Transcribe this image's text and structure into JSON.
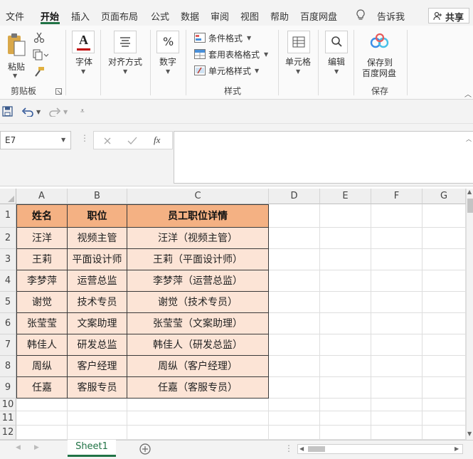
{
  "menu": {
    "tabs": [
      "文件",
      "开始",
      "插入",
      "页面布局",
      "公式",
      "数据",
      "审阅",
      "视图",
      "帮助",
      "百度网盘"
    ],
    "active_tab": "开始",
    "tell_me": "告诉我",
    "share": "共享"
  },
  "ribbon": {
    "clipboard": {
      "paste": "粘贴",
      "group": "剪贴板"
    },
    "font": {
      "label": "字体",
      "icon_char": "A"
    },
    "alignment": {
      "label": "对齐方式"
    },
    "number": {
      "label": "数字",
      "icon_char": "%"
    },
    "styles": {
      "conditional": "条件格式",
      "table_format": "套用表格格式",
      "cell_style": "单元格样式",
      "group": "样式"
    },
    "cells": {
      "label": "单元格"
    },
    "editing": {
      "label": "编辑"
    },
    "save": {
      "line1": "保存到",
      "line2": "百度网盘",
      "group": "保存"
    }
  },
  "formula_bar": {
    "name_box": "E7",
    "fx": "fx",
    "content": ""
  },
  "grid": {
    "columns": [
      "A",
      "B",
      "C",
      "D",
      "E",
      "F",
      "G"
    ],
    "row_numbers": [
      "1",
      "2",
      "3",
      "4",
      "5",
      "6",
      "7",
      "8",
      "9",
      "10",
      "11",
      "12"
    ],
    "header": [
      "姓名",
      "职位",
      "员工职位详情"
    ],
    "rows": [
      [
        "汪洋",
        "视频主管",
        "汪洋（视频主管）"
      ],
      [
        "王莉",
        "平面设计师",
        "王莉（平面设计师）"
      ],
      [
        "李梦萍",
        "运营总监",
        "李梦萍（运营总监）"
      ],
      [
        "谢觉",
        "技术专员",
        "谢觉（技术专员）"
      ],
      [
        "张莹莹",
        "文案助理",
        "张莹莹（文案助理）"
      ],
      [
        "韩佳人",
        "研发总监",
        "韩佳人（研发总监）"
      ],
      [
        "周纵",
        "客户经理",
        "周纵（客户经理）"
      ],
      [
        "任嘉",
        "客服专员",
        "任嘉（客服专员）"
      ]
    ]
  },
  "sheets": {
    "tabs": [
      "Sheet1"
    ],
    "add_icon": "plus-circle-icon"
  },
  "colors": {
    "header_fill": "#f4b183",
    "data_fill": "#fce4d6",
    "accent": "#217346"
  }
}
